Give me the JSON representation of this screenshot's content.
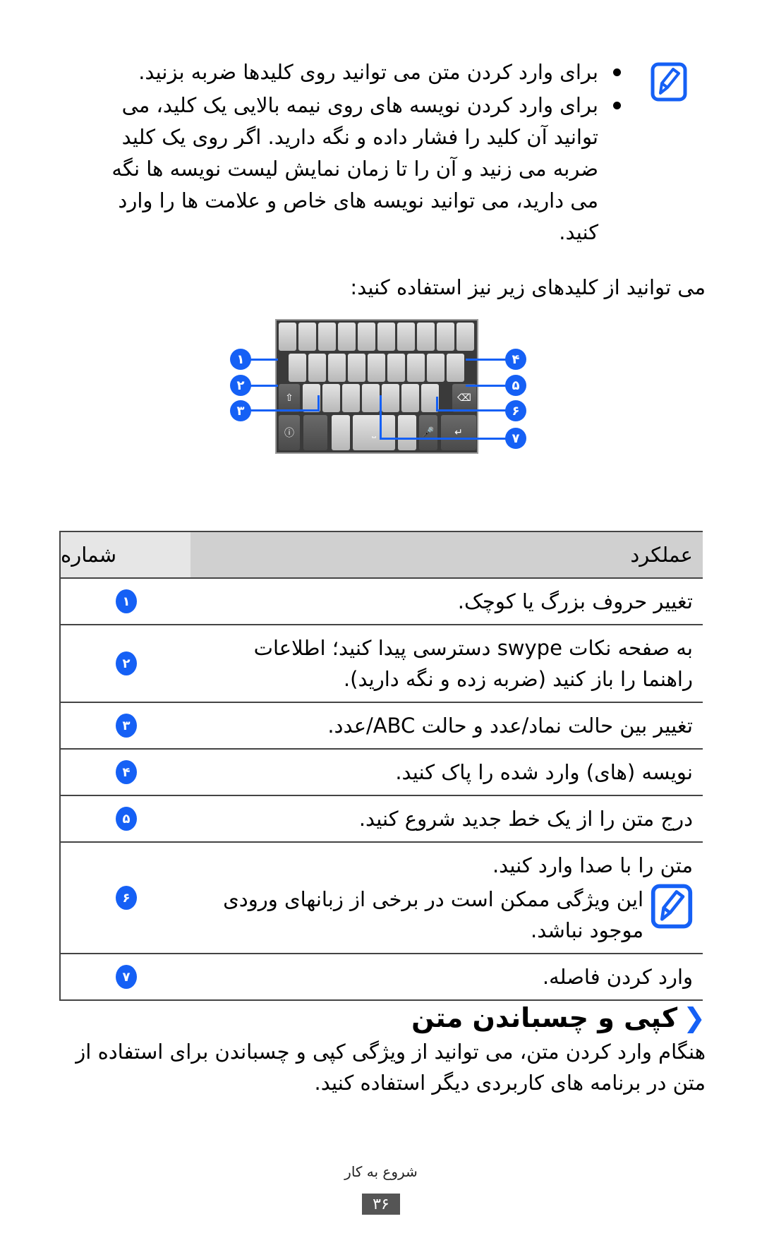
{
  "bullets": [
    "برای وارد کردن متن می توانید روی کلیدها ضربه بزنید.",
    "برای وارد کردن نویسه های روی نیمه بالایی یک کلید، می توانید آن کلید را فشار داده و نگه دارید. اگر روی یک کلید ضربه می زنید و آن را تا زمان نمایش لیست نویسه ها نگه می دارید، می توانید نویسه های خاص و علامت ها را وارد کنید."
  ],
  "intro": "می توانید از کلیدهای زیر نیز استفاده کنید:",
  "callouts": [
    "۱",
    "۲",
    "۳",
    "۴",
    "۵",
    "۶",
    "۷"
  ],
  "keyboard_icons": {
    "shift": "⇧",
    "backspace": "⌫",
    "enter": "↵",
    "mic": "🎤",
    "swype_help": "ⓘ"
  },
  "table": {
    "header_number": "شماره",
    "header_function": "عملکرد",
    "rows": [
      {
        "num": "۱",
        "text": "تغییر حروف بزرگ یا کوچک."
      },
      {
        "num": "۲",
        "text": "به صفحه نکات swype دسترسی پیدا کنید؛ اطلاعات راهنما را باز کنید (ضربه زده و نگه دارید)."
      },
      {
        "num": "۳",
        "text": "تغییر بین حالت نماد/عدد و حالت ABC/عدد."
      },
      {
        "num": "۴",
        "text": "نویسه (های) وارد شده را پاک کنید."
      },
      {
        "num": "۵",
        "text": "درج متن را از یک خط جدید شروع کنید."
      },
      {
        "num": "۶",
        "text": "متن را با صدا وارد کنید.",
        "note": "این ویژگی ممکن است در برخی از زبانهای ورودی موجود نباشد."
      },
      {
        "num": "۷",
        "text": "وارد کردن فاصله."
      }
    ]
  },
  "section": {
    "chevron": "❮",
    "title": "کپی و چسباندن متن",
    "body": "هنگام وارد کردن متن، می توانید از ویژگی کپی و چسباندن برای استفاده از متن در برنامه های کاربردی دیگر استفاده کنید."
  },
  "footer": {
    "label": "شروع به کار",
    "page": "۳۶"
  },
  "colors": {
    "accent": "#1560f5",
    "table_header": "#d0d0d0",
    "page_badge": "#555555"
  }
}
